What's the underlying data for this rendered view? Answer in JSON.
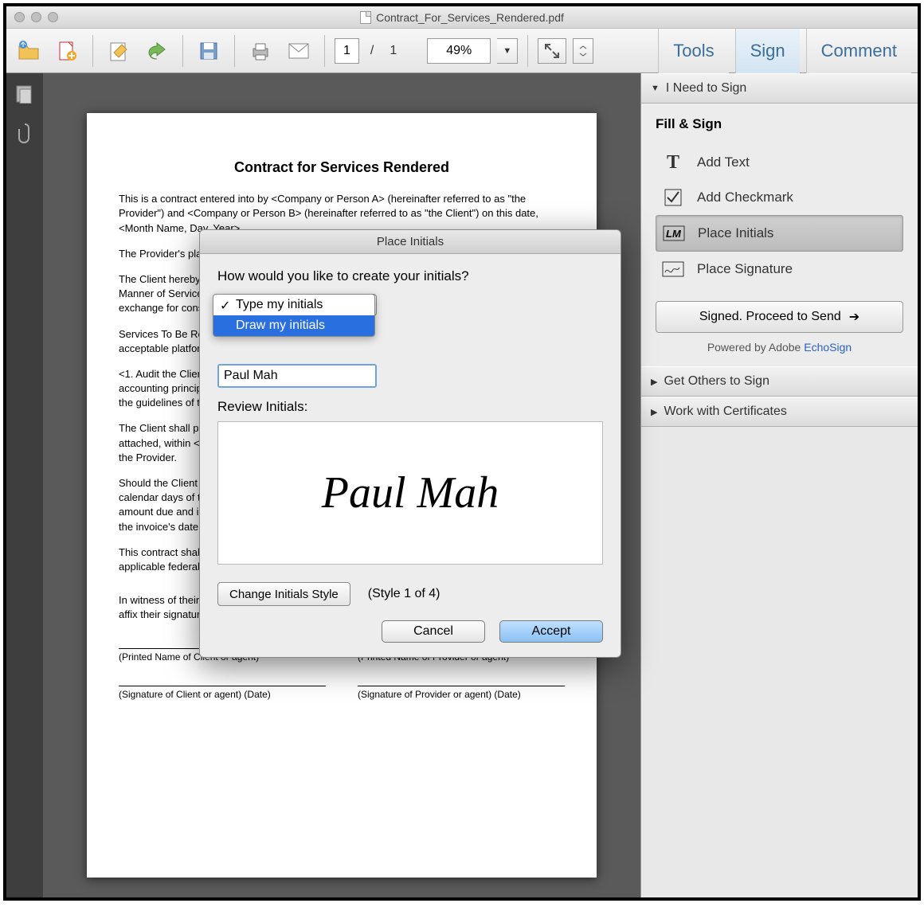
{
  "window": {
    "title": "Contract_For_Services_Rendered.pdf"
  },
  "toolbar": {
    "page_current": "1",
    "page_total": "1",
    "zoom": "49%",
    "right_tabs": {
      "tools": "Tools",
      "sign": "Sign",
      "comment": "Comment"
    }
  },
  "document": {
    "heading": "Contract for Services Rendered",
    "para_intro": "This is a contract entered into by <Company or Person A> (hereinafter referred to as \"the Provider\") and <Company or Person B> (hereinafter referred to as \"the Client\") on this date, <Month Name, Day, Year>.",
    "para_place": "The Provider's place of business is <address> and the Client's place of business is <address>.",
    "para_agree": "The Client hereby engages the Provider to provide services described herein under \"Scope and Manner of Services.\" The Provider hereby agrees to provide the Client with such services in exchange for consideration described herein under \"Payment for Services Rendered.\"",
    "para_scope_head": "Services To Be Rendered — The Provider shall list here platform services for the Client and its acceptable platform requirements in sublists, e.g.:",
    "para_scope_item": "<1. Audit the Client's accounting records for the fiscal year in conformity with generally-accepted accounting principles and the standards of the Public Company Accounting Reform according to the guidelines of the Public Company Accounting Oversight Board.>",
    "para_pay": "The Client shall pay the Provider for services rendered according to the Payment Schedule attached, within <number> calendar days of the date on any invoice for services rendered from the Provider.",
    "para_late": "Should the Client fail to pay the Provider the full amount specified in any invoice within <number> calendar days of the invoice's date, a late fee equal to <dollar amount> shall be added to the amount due and interest of <X> percent per annum shall accrue from the calendar day following the invoice's date.",
    "para_law": "This contract shall be governed by the laws of the State of <State> in <Country> and any applicable federal law.",
    "para_witness": "In witness of their agreement to the terms above, the parties or their authorized agents hereby affix their signatures:",
    "sig_client_name": "(Printed Name of Client or agent)",
    "sig_provider_name": "(Printed Name of Provider or agent)",
    "sig_client_sig": "(Signature of Client or agent) (Date)",
    "sig_provider_sig": "(Signature of Provider or agent) (Date)"
  },
  "signPanel": {
    "sections": {
      "need": "I Need to Sign",
      "others": "Get Others to Sign",
      "certs": "Work with Certificates"
    },
    "fillSignHeading": "Fill & Sign",
    "tools": {
      "addText": "Add Text",
      "addCheckmark": "Add Checkmark",
      "placeInitials": "Place Initials",
      "placeSignature": "Place Signature"
    },
    "proceed": "Signed. Proceed to Send",
    "poweredPrefix": "Powered by Adobe ",
    "poweredLink": "EchoSign"
  },
  "dialog": {
    "title": "Place Initials",
    "question": "How would you like to create your initials?",
    "options": {
      "type": "Type my initials",
      "draw": "Draw my initials"
    },
    "nameValue": "Paul Mah",
    "reviewLabel": "Review Initials:",
    "previewText": "Paul Mah",
    "changeStyle": "Change Initials Style",
    "styleCounter": "(Style 1 of 4)",
    "cancel": "Cancel",
    "accept": "Accept"
  }
}
